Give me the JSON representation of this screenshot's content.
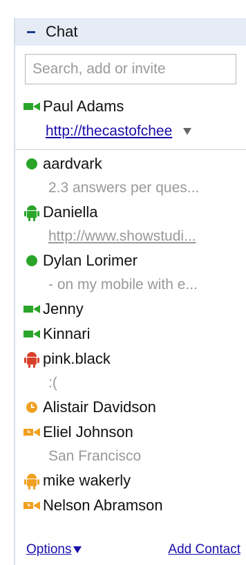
{
  "chat": {
    "title": "Chat",
    "search_placeholder": "Search, add or invite"
  },
  "self": {
    "name": "Paul Adams",
    "status_icon": "video-camera-icon",
    "status_link": "http://thecastofchee"
  },
  "contacts": [
    {
      "name": "aardvark",
      "icon": "green-dot-icon",
      "status": "2.3 answers per ques...",
      "status_is_link": false
    },
    {
      "name": "Daniella",
      "icon": "android-icon",
      "status": "http://www.showstudi...",
      "status_is_link": true
    },
    {
      "name": "Dylan Lorimer",
      "icon": "green-dot-icon",
      "status": "- on my mobile with e...",
      "status_is_link": false
    },
    {
      "name": "Jenny",
      "icon": "video-camera-icon",
      "status": "",
      "status_is_link": false
    },
    {
      "name": "Kinnari",
      "icon": "video-camera-icon",
      "status": "",
      "status_is_link": false
    },
    {
      "name": "pink.black",
      "icon": "android-icon",
      "status": ":(",
      "status_is_link": false
    },
    {
      "name": "Alistair Davidson",
      "icon": "idle-clock-icon",
      "status": "",
      "status_is_link": false
    },
    {
      "name": "Eliel Johnson",
      "icon": "video-camera-icon",
      "status": "San Francisco",
      "status_is_link": false
    },
    {
      "name": "mike wakerly",
      "icon": "android-icon",
      "status": "",
      "status_is_link": false
    },
    {
      "name": "Nelson Abramson",
      "icon": "video-camera-icon",
      "status": "",
      "status_is_link": false
    }
  ],
  "footer": {
    "options_label": "Options",
    "add_contact_label": "Add Contact"
  },
  "colors": {
    "available_green": "#2aa52a",
    "busy_red": "#d9402a",
    "idle_orange": "#f0a020",
    "header_bg": "#e6ecf5",
    "link_blue": "#1a0dab"
  }
}
